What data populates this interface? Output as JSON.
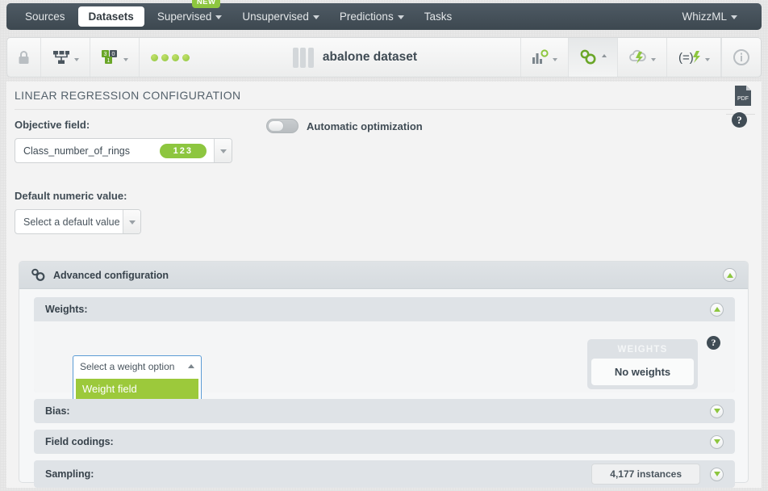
{
  "nav": {
    "items": [
      {
        "label": "Sources",
        "active": false,
        "caret": false
      },
      {
        "label": "Datasets",
        "active": true,
        "caret": false
      },
      {
        "label": "Supervised",
        "active": false,
        "caret": true,
        "badge": "NEW"
      },
      {
        "label": "Unsupervised",
        "active": false,
        "caret": true
      },
      {
        "label": "Predictions",
        "active": false,
        "caret": true
      },
      {
        "label": "Tasks",
        "active": false,
        "caret": false
      }
    ],
    "account": "WhizzML"
  },
  "toolbar": {
    "lock_icon": "lock-icon",
    "tree_icon": "dataset-tree-icon",
    "fields_icon": "field-types-icon",
    "field_counts": [
      "3",
      "0",
      "1"
    ],
    "status_dots": 4,
    "title": "abalone dataset",
    "dataset_icon": "dataset-bars-icon",
    "right_icons": [
      {
        "name": "chart-config-icon",
        "caret": "down"
      },
      {
        "name": "gears-config-icon",
        "caret": "up",
        "active": true
      },
      {
        "name": "cloud-lightning-icon",
        "caret": "down"
      },
      {
        "name": "formula-lightning-icon",
        "caret": "down"
      },
      {
        "name": "info-icon",
        "caret": "none"
      }
    ]
  },
  "page": {
    "title": "LINEAR REGRESSION CONFIGURATION",
    "pdf_icon": "pdf-download-icon",
    "help_icon": "help-question-icon"
  },
  "objective": {
    "label": "Objective field:",
    "value": "Class_number_of_rings",
    "type_badge": "123"
  },
  "automatic_optimization": {
    "label": "Automatic optimization",
    "enabled": false
  },
  "default_numeric": {
    "label": "Default numeric value:",
    "placeholder": "Select a default value"
  },
  "advanced": {
    "label": "Advanced configuration",
    "icon": "gears-icon",
    "expanded": true,
    "sections": [
      {
        "name": "weights",
        "label": "Weights:",
        "expanded": true,
        "select": {
          "value": "Select a weight option",
          "open": true,
          "options": [
            "Weight field"
          ]
        },
        "info": {
          "header": "WEIGHTS",
          "value": "No weights",
          "help_icon": "help-question-icon"
        }
      },
      {
        "name": "bias",
        "label": "Bias:",
        "expanded": false
      },
      {
        "name": "field-codings",
        "label": "Field codings:",
        "expanded": false
      },
      {
        "name": "sampling",
        "label": "Sampling:",
        "expanded": false,
        "badge": "4,177 instances"
      }
    ]
  },
  "colors": {
    "brand_green": "#8dc63f",
    "option_green": "#9cc93b",
    "nav_dark": "#3d4850",
    "text_dark": "#37424b",
    "focus_blue": "#5b9bd5"
  }
}
